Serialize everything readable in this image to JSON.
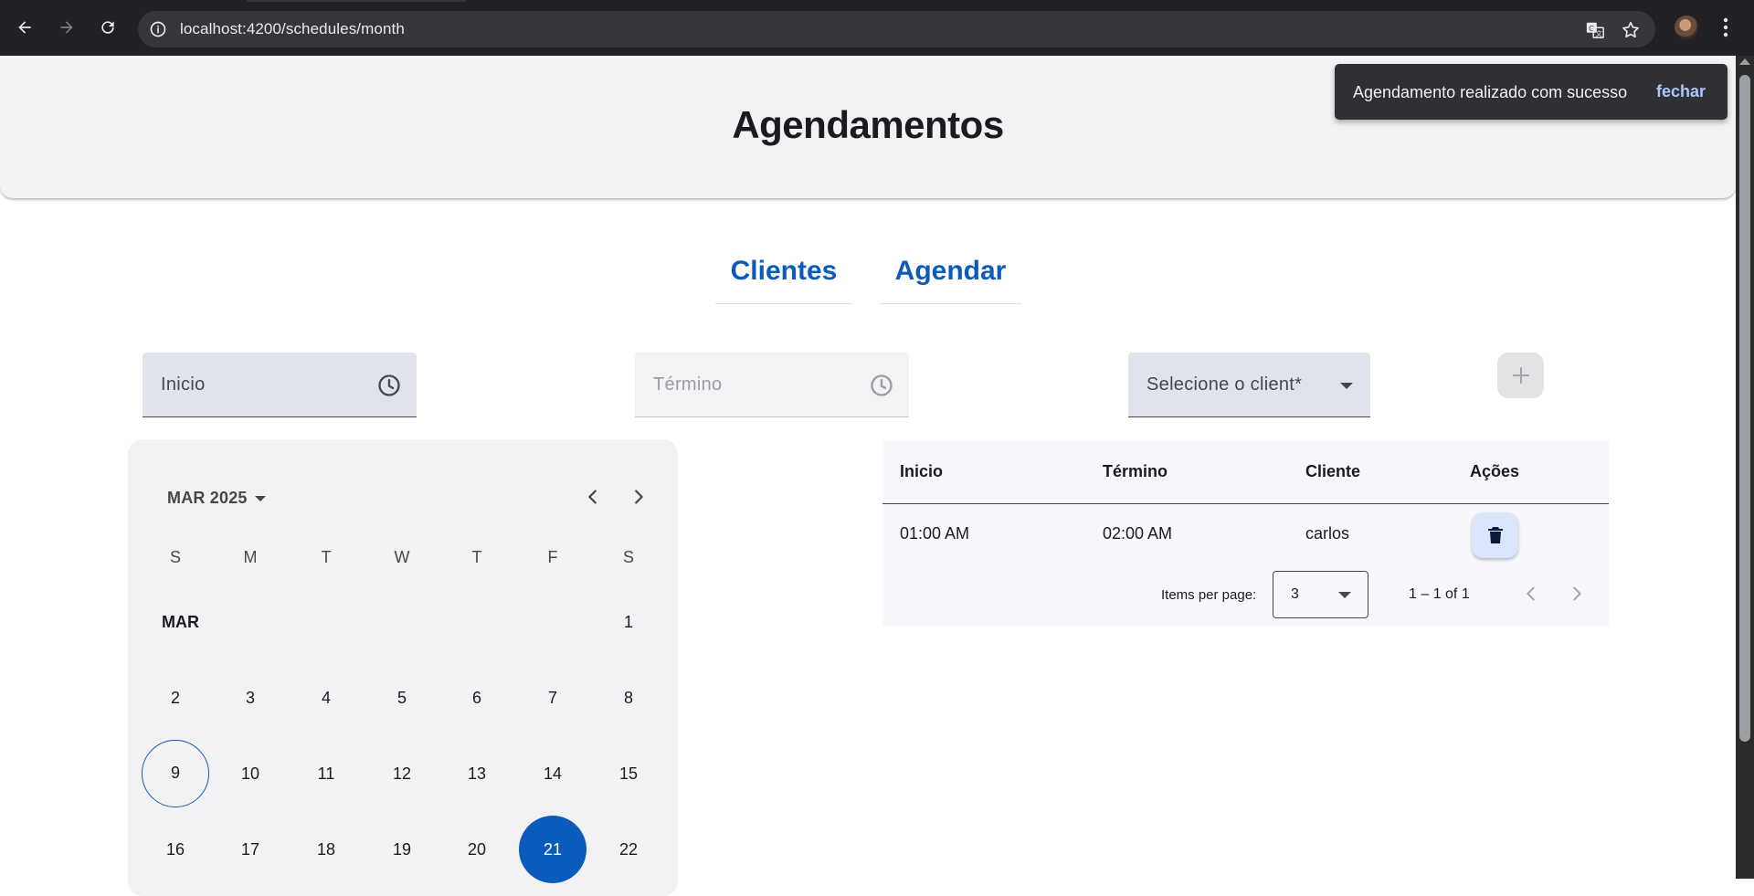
{
  "browser": {
    "url": "localhost:4200/schedules/month"
  },
  "header": {
    "title": "Agendamentos"
  },
  "snackbar": {
    "message": "Agendamento realizado com sucesso",
    "action": "fechar"
  },
  "tabs": [
    {
      "label": "Clientes"
    },
    {
      "label": "Agendar"
    }
  ],
  "form": {
    "start_label": "Inicio",
    "end_label": "Término",
    "client_label": "Selecione o client*",
    "add_icon": "plus-icon"
  },
  "calendar": {
    "period": "MAR 2025",
    "month_label": "MAR",
    "weekdays": [
      "S",
      "M",
      "T",
      "W",
      "T",
      "F",
      "S"
    ],
    "days": [
      "1",
      "2",
      "3",
      "4",
      "5",
      "6",
      "7",
      "8",
      "9",
      "10",
      "11",
      "12",
      "13",
      "14",
      "15",
      "16",
      "17",
      "18",
      "19",
      "20",
      "21",
      "22"
    ],
    "today": "9",
    "selected": "21"
  },
  "table": {
    "headers": [
      "Inicio",
      "Término",
      "Cliente",
      "Ações"
    ],
    "rows": [
      {
        "start": "01:00 AM",
        "end": "02:00 AM",
        "client": "carlos",
        "action_icon": "trash-icon"
      }
    ],
    "paginator": {
      "items_per_page_label": "Items per page:",
      "page_size": "3",
      "range": "1 – 1 of 1"
    }
  },
  "colors": {
    "primary": "#0b5cba",
    "surface": "#f2f2f4",
    "browser_chrome": "#202124",
    "snackbar": "#2f3033",
    "snackbar_action": "#a8c7fa"
  }
}
